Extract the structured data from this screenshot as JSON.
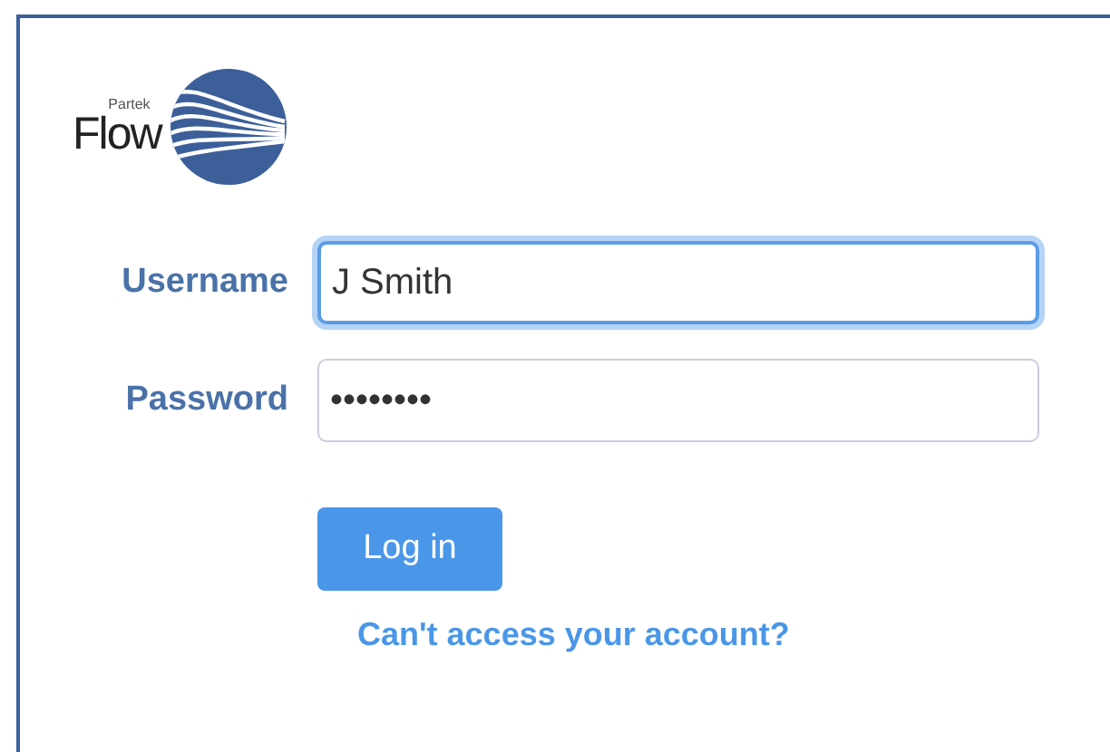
{
  "logo": {
    "small_text": "Partek",
    "large_text": "Flow"
  },
  "fields": [
    {
      "label": "Username",
      "value": "J Smith",
      "focused": true
    },
    {
      "label": "Password",
      "value": "••••••••",
      "focused": false
    }
  ],
  "button": "Log in",
  "link": "Can't access your account?"
}
